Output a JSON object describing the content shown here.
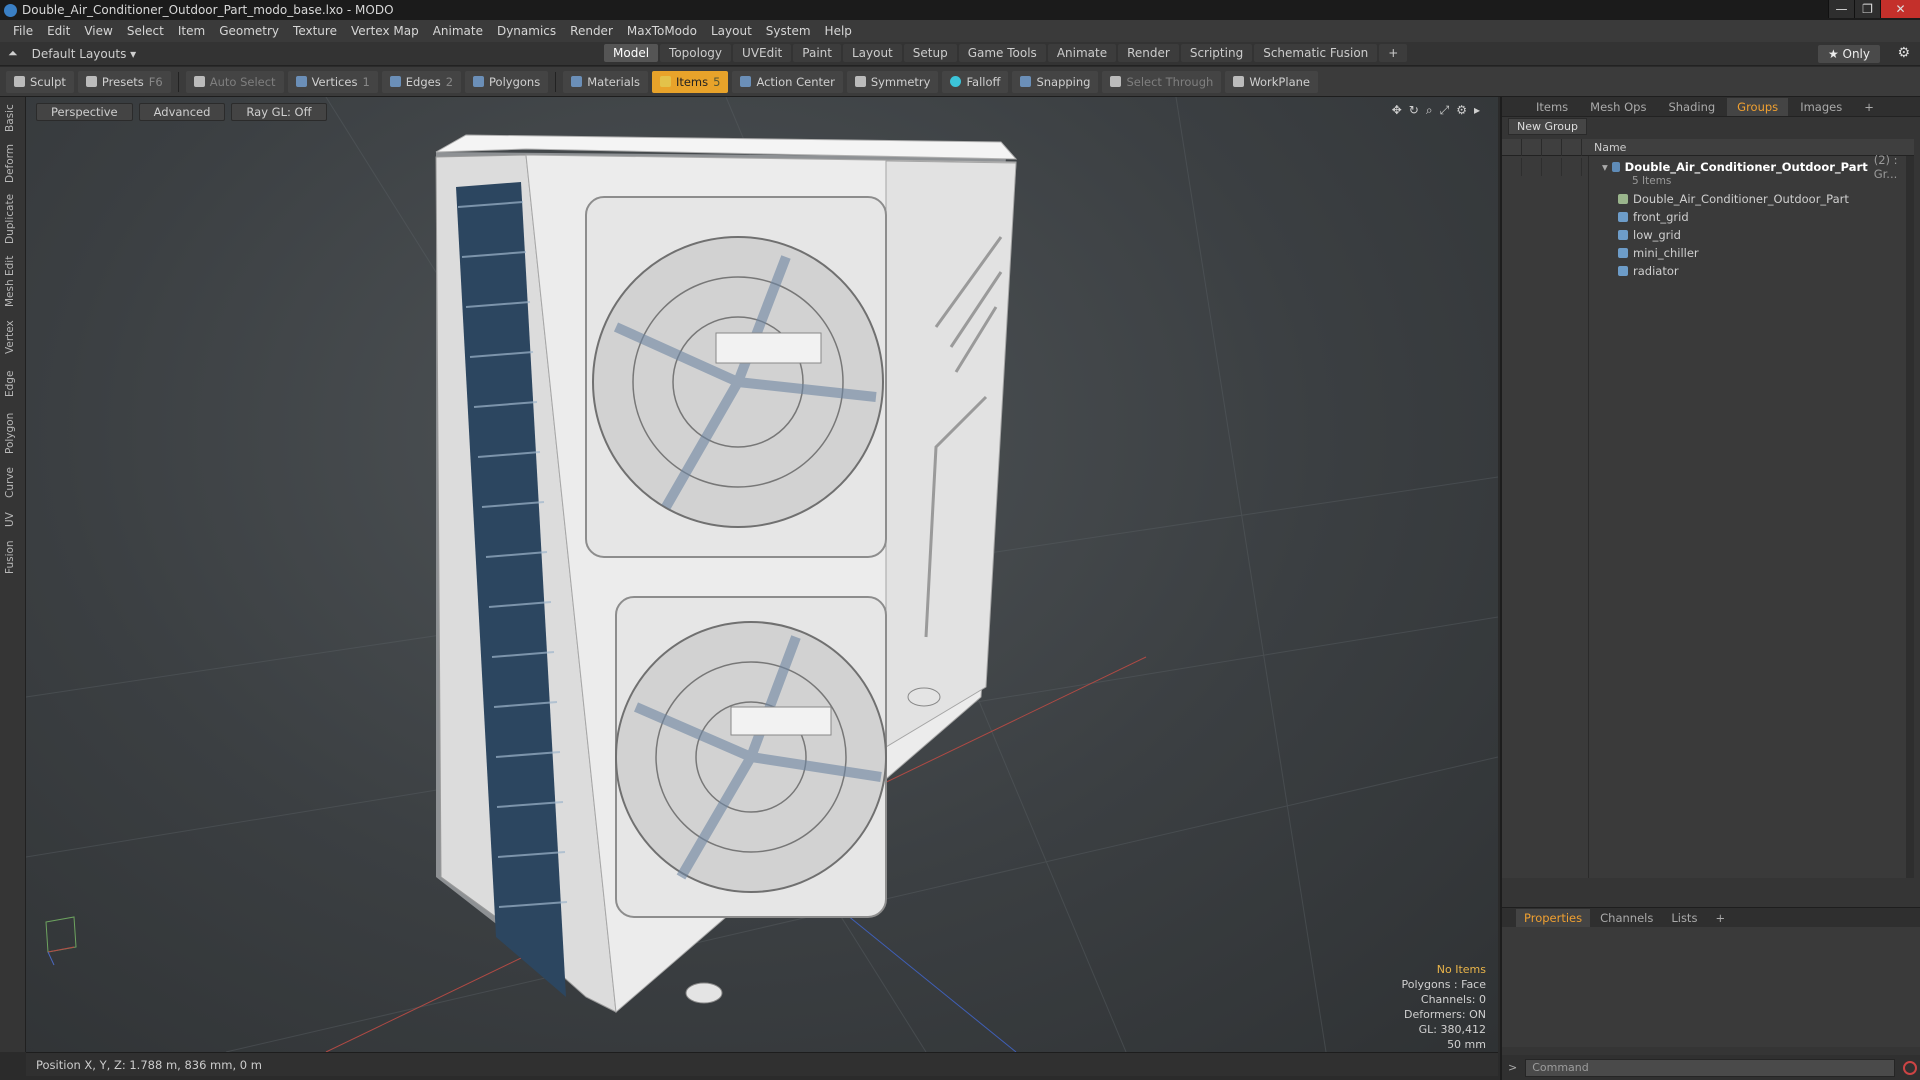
{
  "window": {
    "title": "Double_Air_Conditioner_Outdoor_Part_modo_base.lxo - MODO"
  },
  "menu": [
    "File",
    "Edit",
    "View",
    "Select",
    "Item",
    "Geometry",
    "Texture",
    "Vertex Map",
    "Animate",
    "Dynamics",
    "Render",
    "MaxToModo",
    "Layout",
    "System",
    "Help"
  ],
  "layouts": {
    "default": "Default Layouts ▾",
    "only": "★ Only"
  },
  "layout_tabs": [
    "Model",
    "Topology",
    "UVEdit",
    "Paint",
    "Layout",
    "Setup",
    "Game Tools",
    "Animate",
    "Render",
    "Scripting",
    "Schematic Fusion"
  ],
  "toolbar": {
    "sculpt": "Sculpt",
    "presets": "Presets",
    "presets_key": "F6",
    "auto_select": "Auto Select",
    "vertices": "Vertices",
    "vertices_num": "1",
    "edges": "Edges",
    "edges_num": "2",
    "polygons": "Polygons",
    "materials": "Materials",
    "items": "Items",
    "items_num": "5",
    "action_center": "Action Center",
    "symmetry": "Symmetry",
    "falloff": "Falloff",
    "snapping": "Snapping",
    "select_through": "Select Through",
    "workplane": "WorkPlane"
  },
  "left_tabs": [
    "Basic",
    "Deform",
    "Duplicate",
    "Mesh Edit",
    "Vertex",
    "Edge",
    "Polygon",
    "Curve",
    "UV",
    "Fusion"
  ],
  "viewport": {
    "perspective": "Perspective",
    "advanced": "Advanced",
    "raygl": "Ray GL: Off",
    "stats": {
      "no_items": "No Items",
      "polygons": "Polygons : Face",
      "channels": "Channels: 0",
      "deformers": "Deformers: ON",
      "gl": "GL: 380,412",
      "scale": "50 mm"
    }
  },
  "status": {
    "position": "Position X, Y, Z:   1.788 m, 836 mm, 0 m"
  },
  "right_tabs": [
    "Items",
    "Mesh Ops",
    "Shading",
    "Groups",
    "Images"
  ],
  "groups": {
    "new_group": "New Group",
    "name_header": "Name",
    "root": "Double_Air_Conditioner_Outdoor_Part",
    "root_suffix": "(2) : Gr...",
    "root_sub": "5 Items",
    "items": [
      "Double_Air_Conditioner_Outdoor_Part",
      "front_grid",
      "low_grid",
      "mini_chiller",
      "radiator"
    ]
  },
  "lower_tabs": [
    "Properties",
    "Channels",
    "Lists"
  ],
  "command": {
    "placeholder": "Command"
  }
}
